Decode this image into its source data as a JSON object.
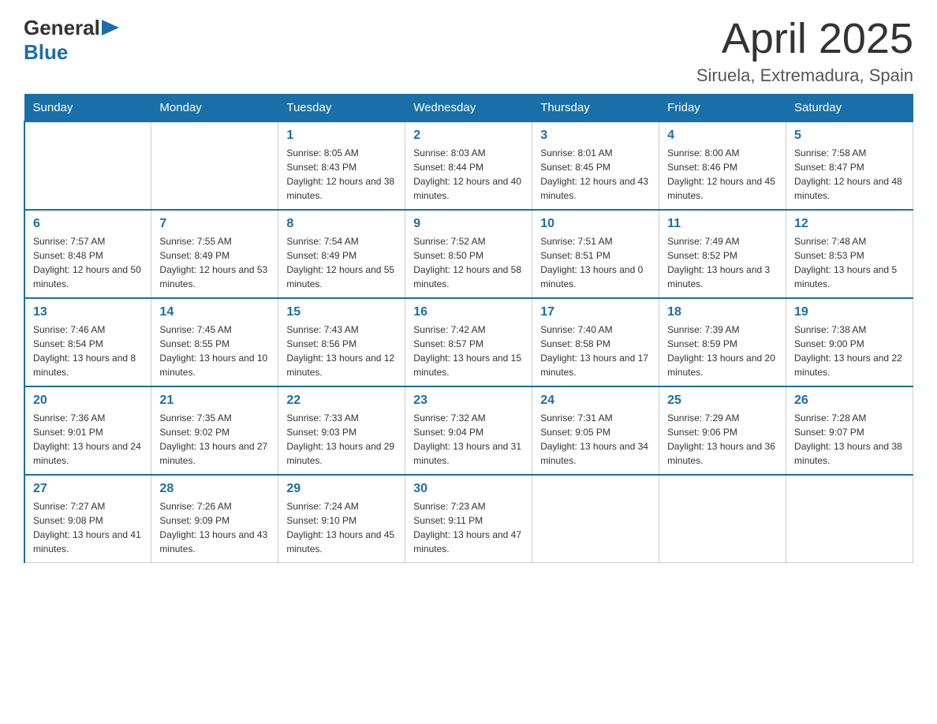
{
  "logo": {
    "text_general": "General",
    "text_blue": "Blue",
    "arrow": "▶"
  },
  "title": "April 2025",
  "location": "Siruela, Extremadura, Spain",
  "days_of_week": [
    "Sunday",
    "Monday",
    "Tuesday",
    "Wednesday",
    "Thursday",
    "Friday",
    "Saturday"
  ],
  "weeks": [
    [
      {
        "day": "",
        "sunrise": "",
        "sunset": "",
        "daylight": ""
      },
      {
        "day": "",
        "sunrise": "",
        "sunset": "",
        "daylight": ""
      },
      {
        "day": "1",
        "sunrise": "Sunrise: 8:05 AM",
        "sunset": "Sunset: 8:43 PM",
        "daylight": "Daylight: 12 hours and 38 minutes."
      },
      {
        "day": "2",
        "sunrise": "Sunrise: 8:03 AM",
        "sunset": "Sunset: 8:44 PM",
        "daylight": "Daylight: 12 hours and 40 minutes."
      },
      {
        "day": "3",
        "sunrise": "Sunrise: 8:01 AM",
        "sunset": "Sunset: 8:45 PM",
        "daylight": "Daylight: 12 hours and 43 minutes."
      },
      {
        "day": "4",
        "sunrise": "Sunrise: 8:00 AM",
        "sunset": "Sunset: 8:46 PM",
        "daylight": "Daylight: 12 hours and 45 minutes."
      },
      {
        "day": "5",
        "sunrise": "Sunrise: 7:58 AM",
        "sunset": "Sunset: 8:47 PM",
        "daylight": "Daylight: 12 hours and 48 minutes."
      }
    ],
    [
      {
        "day": "6",
        "sunrise": "Sunrise: 7:57 AM",
        "sunset": "Sunset: 8:48 PM",
        "daylight": "Daylight: 12 hours and 50 minutes."
      },
      {
        "day": "7",
        "sunrise": "Sunrise: 7:55 AM",
        "sunset": "Sunset: 8:49 PM",
        "daylight": "Daylight: 12 hours and 53 minutes."
      },
      {
        "day": "8",
        "sunrise": "Sunrise: 7:54 AM",
        "sunset": "Sunset: 8:49 PM",
        "daylight": "Daylight: 12 hours and 55 minutes."
      },
      {
        "day": "9",
        "sunrise": "Sunrise: 7:52 AM",
        "sunset": "Sunset: 8:50 PM",
        "daylight": "Daylight: 12 hours and 58 minutes."
      },
      {
        "day": "10",
        "sunrise": "Sunrise: 7:51 AM",
        "sunset": "Sunset: 8:51 PM",
        "daylight": "Daylight: 13 hours and 0 minutes."
      },
      {
        "day": "11",
        "sunrise": "Sunrise: 7:49 AM",
        "sunset": "Sunset: 8:52 PM",
        "daylight": "Daylight: 13 hours and 3 minutes."
      },
      {
        "day": "12",
        "sunrise": "Sunrise: 7:48 AM",
        "sunset": "Sunset: 8:53 PM",
        "daylight": "Daylight: 13 hours and 5 minutes."
      }
    ],
    [
      {
        "day": "13",
        "sunrise": "Sunrise: 7:46 AM",
        "sunset": "Sunset: 8:54 PM",
        "daylight": "Daylight: 13 hours and 8 minutes."
      },
      {
        "day": "14",
        "sunrise": "Sunrise: 7:45 AM",
        "sunset": "Sunset: 8:55 PM",
        "daylight": "Daylight: 13 hours and 10 minutes."
      },
      {
        "day": "15",
        "sunrise": "Sunrise: 7:43 AM",
        "sunset": "Sunset: 8:56 PM",
        "daylight": "Daylight: 13 hours and 12 minutes."
      },
      {
        "day": "16",
        "sunrise": "Sunrise: 7:42 AM",
        "sunset": "Sunset: 8:57 PM",
        "daylight": "Daylight: 13 hours and 15 minutes."
      },
      {
        "day": "17",
        "sunrise": "Sunrise: 7:40 AM",
        "sunset": "Sunset: 8:58 PM",
        "daylight": "Daylight: 13 hours and 17 minutes."
      },
      {
        "day": "18",
        "sunrise": "Sunrise: 7:39 AM",
        "sunset": "Sunset: 8:59 PM",
        "daylight": "Daylight: 13 hours and 20 minutes."
      },
      {
        "day": "19",
        "sunrise": "Sunrise: 7:38 AM",
        "sunset": "Sunset: 9:00 PM",
        "daylight": "Daylight: 13 hours and 22 minutes."
      }
    ],
    [
      {
        "day": "20",
        "sunrise": "Sunrise: 7:36 AM",
        "sunset": "Sunset: 9:01 PM",
        "daylight": "Daylight: 13 hours and 24 minutes."
      },
      {
        "day": "21",
        "sunrise": "Sunrise: 7:35 AM",
        "sunset": "Sunset: 9:02 PM",
        "daylight": "Daylight: 13 hours and 27 minutes."
      },
      {
        "day": "22",
        "sunrise": "Sunrise: 7:33 AM",
        "sunset": "Sunset: 9:03 PM",
        "daylight": "Daylight: 13 hours and 29 minutes."
      },
      {
        "day": "23",
        "sunrise": "Sunrise: 7:32 AM",
        "sunset": "Sunset: 9:04 PM",
        "daylight": "Daylight: 13 hours and 31 minutes."
      },
      {
        "day": "24",
        "sunrise": "Sunrise: 7:31 AM",
        "sunset": "Sunset: 9:05 PM",
        "daylight": "Daylight: 13 hours and 34 minutes."
      },
      {
        "day": "25",
        "sunrise": "Sunrise: 7:29 AM",
        "sunset": "Sunset: 9:06 PM",
        "daylight": "Daylight: 13 hours and 36 minutes."
      },
      {
        "day": "26",
        "sunrise": "Sunrise: 7:28 AM",
        "sunset": "Sunset: 9:07 PM",
        "daylight": "Daylight: 13 hours and 38 minutes."
      }
    ],
    [
      {
        "day": "27",
        "sunrise": "Sunrise: 7:27 AM",
        "sunset": "Sunset: 9:08 PM",
        "daylight": "Daylight: 13 hours and 41 minutes."
      },
      {
        "day": "28",
        "sunrise": "Sunrise: 7:26 AM",
        "sunset": "Sunset: 9:09 PM",
        "daylight": "Daylight: 13 hours and 43 minutes."
      },
      {
        "day": "29",
        "sunrise": "Sunrise: 7:24 AM",
        "sunset": "Sunset: 9:10 PM",
        "daylight": "Daylight: 13 hours and 45 minutes."
      },
      {
        "day": "30",
        "sunrise": "Sunrise: 7:23 AM",
        "sunset": "Sunset: 9:11 PM",
        "daylight": "Daylight: 13 hours and 47 minutes."
      },
      {
        "day": "",
        "sunrise": "",
        "sunset": "",
        "daylight": ""
      },
      {
        "day": "",
        "sunrise": "",
        "sunset": "",
        "daylight": ""
      },
      {
        "day": "",
        "sunrise": "",
        "sunset": "",
        "daylight": ""
      }
    ]
  ]
}
